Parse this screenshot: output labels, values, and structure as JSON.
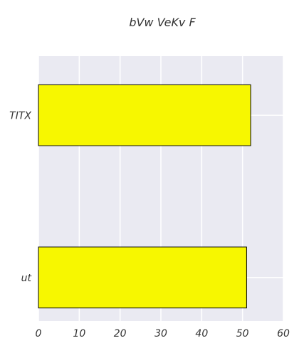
{
  "chart_data": {
    "type": "bar",
    "orientation": "horizontal",
    "title": "bVw VeKv  F",
    "xlabel": "",
    "ylabel": "",
    "categories": [
      "TITX",
      "ut"
    ],
    "values": [
      52,
      51
    ],
    "xlim": [
      0,
      60
    ],
    "xticks": [
      0,
      10,
      20,
      30,
      40,
      50,
      60
    ],
    "grid": true,
    "legend": "none",
    "colors": {
      "bar_fill": "#f7f700",
      "bar_edge": "#000000",
      "plot_background": "#eaeaf2",
      "grid": "#ffffff",
      "text": "#333333"
    }
  }
}
